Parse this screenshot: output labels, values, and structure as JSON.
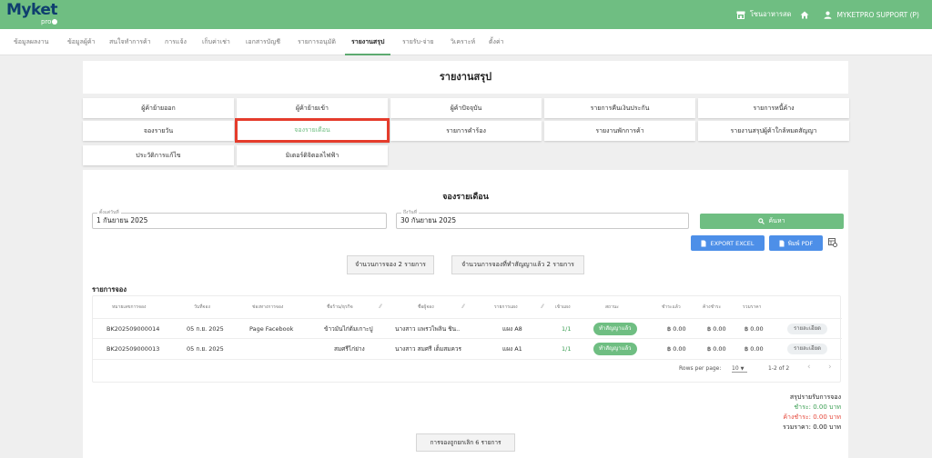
{
  "brand": {
    "name": "Myket",
    "sub": "pro"
  },
  "topbar": {
    "shop_label": "โซนอาหารสด",
    "user_label": "MYKETPRO SUPPORT (P)"
  },
  "nav": {
    "tabs": [
      {
        "label": "ข้อมูลผลงาน"
      },
      {
        "label": "ข้อมูลผู้ค้า"
      },
      {
        "label": "สนใจทำการค้า"
      },
      {
        "label": "การแจ้ง"
      },
      {
        "label": "เก็บค่าเช่า"
      },
      {
        "label": "เอกสารบัญชี"
      },
      {
        "label": "รายการอนุมัติ"
      },
      {
        "label": "รายงานสรุป"
      },
      {
        "label": "รายรับ-จ่าย"
      },
      {
        "label": "วิเคราะห์"
      },
      {
        "label": "ตั้งค่า"
      }
    ],
    "active": "รายงานสรุป"
  },
  "report": {
    "title": "รายงานสรุป",
    "buttons": [
      {
        "label": "ผู้ค้าย้ายออก"
      },
      {
        "label": "ผู้ค้าย้ายเข้า"
      },
      {
        "label": "ผู้ค้าปัจจุบัน"
      },
      {
        "label": "รายการคืนเงินประกัน"
      },
      {
        "label": "รายการหนี้ค้าง"
      },
      {
        "label": "จองรายวัน"
      },
      {
        "label": "จองรายเดือน"
      },
      {
        "label": "รายการคำร้อง"
      },
      {
        "label": "รายงานพักการค้า"
      },
      {
        "label": "รายงานสรุปผู้ค้าใกล้หมดสัญญา"
      },
      {
        "label": "ประวัติการแก้ไข"
      },
      {
        "label": "มิเตอร์ดิจิตอลไฟฟ้า"
      }
    ]
  },
  "monthly": {
    "title": "จองรายเดือน",
    "start_label": "ตั้งแต่วันที่",
    "start_value": "1 กันยายน 2025",
    "end_label": "ถึงวันที่",
    "end_value": "30 กันยายน 2025",
    "search_label": "ค้นหา",
    "export_excel": "EXPORT EXCEL",
    "print_pdf": "พิมพ์ PDF",
    "count_booking": "จำนวนการจอง 2 รายการ",
    "count_contract": "จำนวนการจองที่ทำสัญญาแล้ว 2 รายการ"
  },
  "table": {
    "title": "รายการจอง",
    "headers": [
      "หมายเลขการจอง",
      "วันที่จอง",
      "ช่องทางการจอง",
      "ชื่อร้าน/ธุรกิจ",
      "ชื่อผู้จอง",
      "รายการแผง",
      "เข้าแผง",
      "สถานะ",
      "ชำระแล้ว",
      "ค้างชำระ",
      "รวมราคา"
    ],
    "rows": [
      {
        "id": "BK202509000014",
        "date": "05 ก.ย. 2025",
        "channel": "Page Facebook",
        "shop": "ข้าวมันไก่ต้มเกาะปู",
        "name": "นางสาว แพรวไพลิน ชิน..",
        "stall": "แผง A8",
        "enter": "1/1",
        "status": "ทำสัญญาแล้ว",
        "paid": "฿ 0.00",
        "due": "฿ 0.00",
        "total": "฿ 0.00",
        "action": "รายละเอียด"
      },
      {
        "id": "BK202509000013",
        "date": "05 ก.ย. 2025",
        "channel": "",
        "shop": "สมศรีไก่ย่าง",
        "name": "นางสาว สมศรี เต็มสมควร",
        "stall": "แผง A1",
        "enter": "1/1",
        "status": "ทำสัญญาแล้ว",
        "paid": "฿ 0.00",
        "due": "฿ 0.00",
        "total": "฿ 0.00",
        "action": "รายละเอียด"
      }
    ],
    "rows_per_page_label": "Rows per page:",
    "rows_per_page": "10",
    "range": "1-2 of 2"
  },
  "summary": {
    "title": "สรุปรายรับการจอง",
    "paid": "ชำระ: 0.00 บาท",
    "due": "ค้างชำระ: 0.00 บาท",
    "total": "รวมราคา: 0.00 บาท"
  },
  "footer": {
    "cancelled": "การจองถูกยกเลิก 6 รายการ"
  },
  "colors": {
    "brand_green": "#6fbe82",
    "active_outline": "#e53c2c",
    "button_blue": "#4d8fe8",
    "due_red": "#e5483b"
  }
}
